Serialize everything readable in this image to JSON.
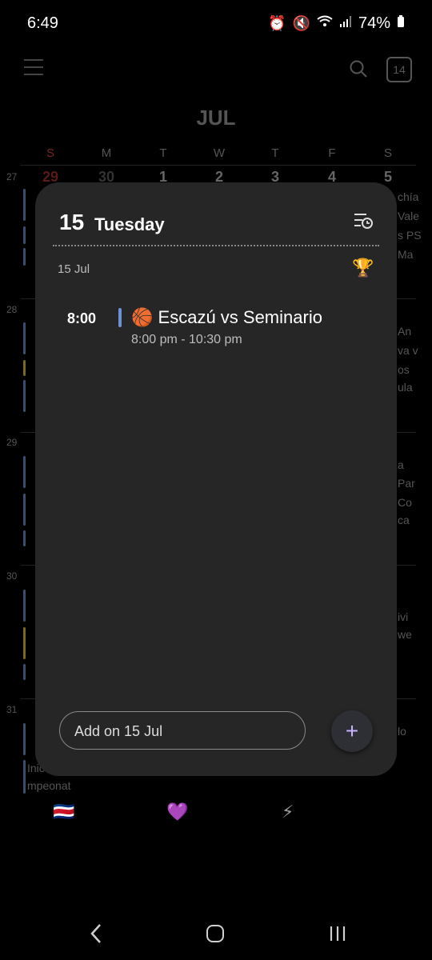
{
  "status": {
    "time": "6:49",
    "battery": "74%",
    "icons": [
      "alarm-icon",
      "mute-icon",
      "wifi-icon",
      "signal-icon",
      "battery-icon"
    ]
  },
  "header": {
    "month": "JUL",
    "today_badge": "14"
  },
  "calendar": {
    "dow": [
      "S",
      "M",
      "T",
      "W",
      "T",
      "F",
      "S"
    ],
    "first_row_days": [
      "29",
      "30",
      "1",
      "2",
      "3",
      "4",
      "5"
    ],
    "week_numbers": [
      "27",
      "28",
      "29",
      "30",
      "31"
    ],
    "bg_snippets": [
      "chía",
      "Vale",
      "s PS",
      "Ma",
      "An",
      "va v",
      "os",
      "ula",
      "a",
      "Par",
      "Co",
      "ca",
      "ivi",
      "we",
      "lo",
      "Inic",
      "mpeonat"
    ],
    "bottom_emojis": [
      "🇨🇷",
      "💜",
      "⚡"
    ]
  },
  "popup": {
    "day_number": "15",
    "day_name": "Tuesday",
    "date_label": "15 Jul",
    "trophy_emoji": "🏆",
    "event": {
      "time": "8:00",
      "emoji": "🏀",
      "title": "Escazú vs Seminario",
      "range": "8:00 pm - 10:30 pm",
      "color": "#6f8fd6"
    },
    "add_placeholder": "Add on 15 Jul",
    "add_button_label": "+"
  },
  "colors": {
    "card_bg": "#262626",
    "accent": "#c9b3ff"
  }
}
